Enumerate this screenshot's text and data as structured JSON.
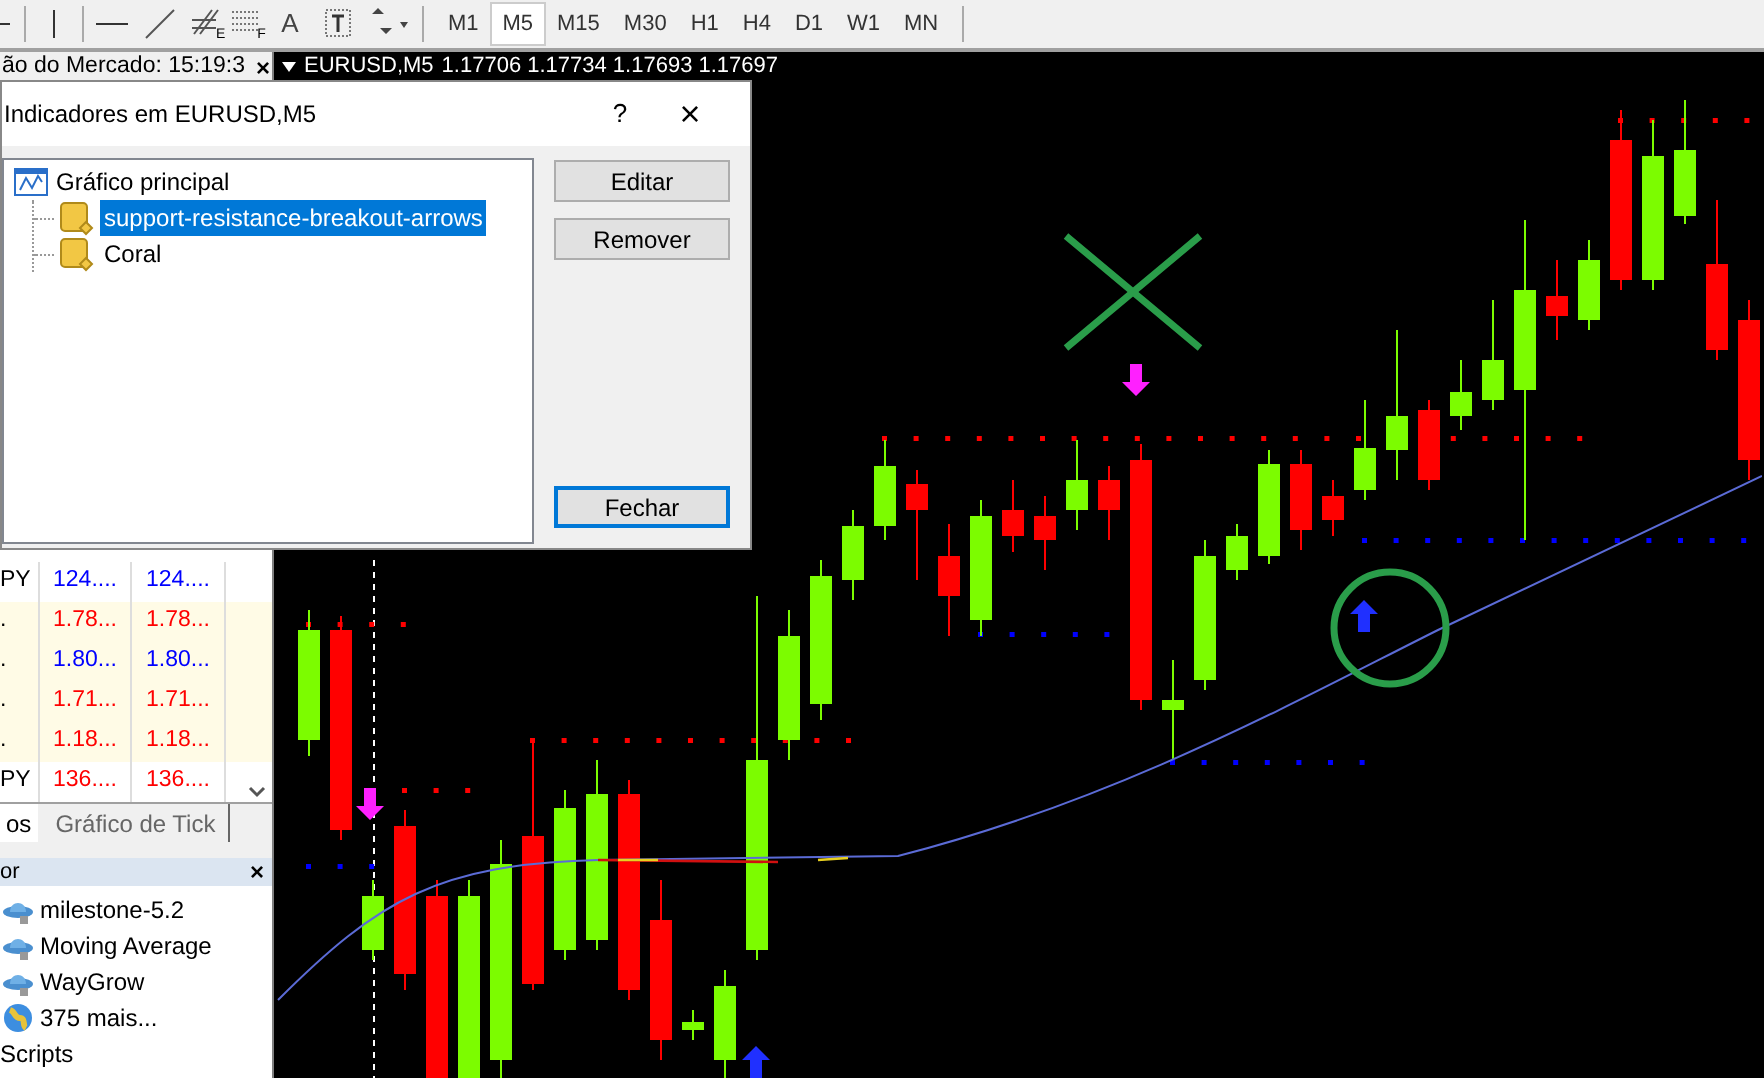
{
  "toolbar": {
    "tools": [
      {
        "kind": "dash"
      },
      {
        "kind": "vline"
      },
      {
        "kind": "hline"
      },
      {
        "kind": "trend"
      },
      {
        "kind": "fibo",
        "letter": "E"
      },
      {
        "kind": "grid",
        "letter": "F"
      },
      {
        "kind": "text",
        "letter": "A"
      },
      {
        "kind": "label"
      },
      {
        "kind": "arrows"
      }
    ],
    "periods": [
      {
        "label": "M1",
        "selected": false
      },
      {
        "label": "M5",
        "selected": true
      },
      {
        "label": "M15",
        "selected": false
      },
      {
        "label": "M30",
        "selected": false
      },
      {
        "label": "H1",
        "selected": false
      },
      {
        "label": "H4",
        "selected": false
      },
      {
        "label": "D1",
        "selected": false
      },
      {
        "label": "W1",
        "selected": false
      },
      {
        "label": "MN",
        "selected": false
      }
    ]
  },
  "market_watch": {
    "title": "ão do Mercado: 15:19:3",
    "close": "×",
    "rows": [
      {
        "symbol": "PY",
        "bid": "124....",
        "ask": "124....",
        "color": "#0000ff"
      },
      {
        "symbol": ".",
        "bid": "1.78...",
        "ask": "1.78...",
        "color": "#ff0000"
      },
      {
        "symbol": ".",
        "bid": "1.80...",
        "ask": "1.80...",
        "color": "#0000ff"
      },
      {
        "symbol": ".",
        "bid": "1.71...",
        "ask": "1.71...",
        "color": "#ff0000"
      },
      {
        "symbol": ".",
        "bid": "1.18...",
        "ask": "1.18...",
        "color": "#ff0000"
      },
      {
        "symbol": "PY",
        "bid": "136....",
        "ask": "136....",
        "color": "#ff0000"
      }
    ],
    "tabs": [
      {
        "label": "os",
        "selected": true
      },
      {
        "label": "Gráfico de Tick",
        "selected": false
      }
    ]
  },
  "navigator": {
    "title": "or",
    "close": "×",
    "items": [
      {
        "kind": "expert",
        "label": "milestone-5.2"
      },
      {
        "kind": "expert",
        "label": "Moving Average"
      },
      {
        "kind": "expert",
        "label": "WayGrow"
      },
      {
        "kind": "more",
        "label": "375 mais..."
      },
      {
        "kind": "group",
        "label": "Scripts"
      }
    ]
  },
  "chart": {
    "title": "EURUSD,M5",
    "prices": "1.17706 1.17734 1.17693 1.17697"
  },
  "dialog": {
    "title": "Indicadores em EURUSD,M5",
    "help": "?",
    "close": "×",
    "tree": {
      "label": "Gráfico principal",
      "expanded": true,
      "children": [
        {
          "label": "support-resistance-breakout-arrows",
          "selected": true
        },
        {
          "label": "Coral",
          "selected": false
        }
      ]
    },
    "buttons": [
      {
        "label": "Editar",
        "default": false
      },
      {
        "label": "Remover",
        "default": false
      },
      {
        "label": "Fechar",
        "default": true
      }
    ]
  }
}
